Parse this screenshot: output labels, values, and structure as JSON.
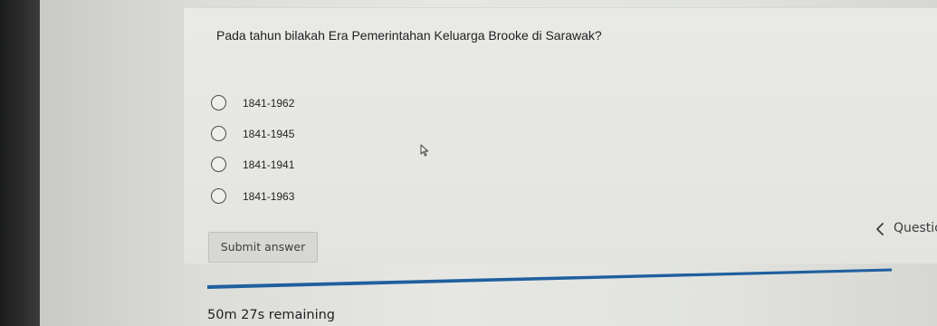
{
  "quiz": {
    "question": "Pada tahun bilakah Era Pemerintahan Keluarga Brooke di Sarawak?",
    "options": [
      {
        "label": "1841-1962",
        "selected": false
      },
      {
        "label": "1841-1945",
        "selected": false
      },
      {
        "label": "1841-1941",
        "selected": false
      },
      {
        "label": "1841-1963",
        "selected": false
      }
    ],
    "submit_label": "Submit answer"
  },
  "navigation": {
    "question_label": "Questic",
    "icon": "chevron-left-icon"
  },
  "timer": {
    "remaining_text": "50m 27s remaining",
    "progress_color": "#1f5f9e"
  },
  "colors": {
    "accent": "#1f5f9e",
    "text": "#1e1f20"
  }
}
